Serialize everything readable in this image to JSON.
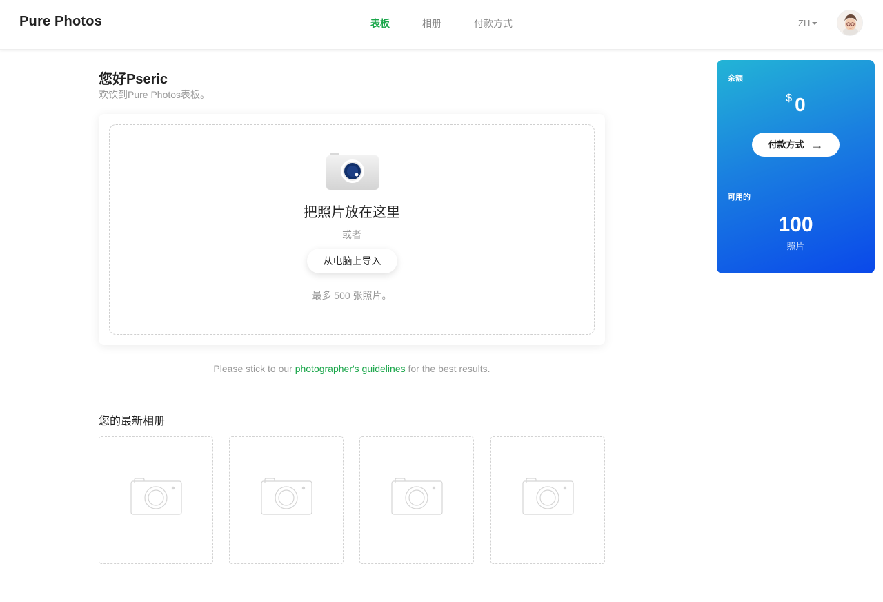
{
  "header": {
    "logo": "Pure Photos",
    "nav": [
      {
        "label": "表板",
        "active": true
      },
      {
        "label": "相册",
        "active": false
      },
      {
        "label": "付款方式",
        "active": false
      }
    ],
    "language": "ZH"
  },
  "main": {
    "greeting": "您好Pseric",
    "subgreeting": "欢饮到Pure Photos表板。",
    "upload": {
      "title": "把照片放在这里",
      "or": "或者",
      "import_button": "从电脑上导入",
      "max_note": "最多 500 张照片。"
    },
    "guidelines": {
      "prefix": "Please stick to our ",
      "link": "photographer's guidelines",
      "suffix": " for the best results."
    },
    "latest_albums": {
      "title": "您的最新相册",
      "placeholders": 4
    }
  },
  "balance_card": {
    "balance_label": "余额",
    "currency": "$",
    "balance": "0",
    "payment_button": "付款方式",
    "available_label": "可用的",
    "available_count": "100",
    "available_unit": "照片"
  },
  "colors": {
    "accent_green": "#1aa64a",
    "card_gradient_start": "#23b4d6",
    "card_gradient_end": "#0a48ea"
  }
}
